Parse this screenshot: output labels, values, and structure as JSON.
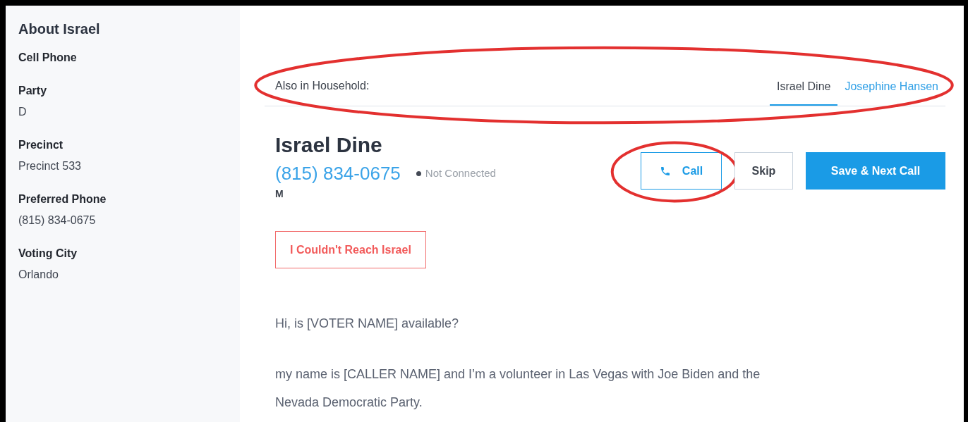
{
  "sidebar": {
    "title": "About Israel",
    "fields": [
      {
        "label": "Cell Phone"
      },
      {
        "label": "Party",
        "value": "D"
      },
      {
        "label": "Precinct",
        "value": "Precinct 533"
      },
      {
        "label": "Preferred Phone",
        "value": "(815) 834-0675"
      },
      {
        "label": "Voting City",
        "value": "Orlando"
      }
    ]
  },
  "household": {
    "label": "Also in Household:",
    "circled": true,
    "members": [
      {
        "name": "Israel Dine",
        "selected": true
      },
      {
        "name": "Josephine Hansen",
        "selected": false
      }
    ]
  },
  "contact": {
    "name": "Israel Dine",
    "phone": "(815) 834-0675",
    "status": "Not Connected",
    "gender": "M"
  },
  "actions": [
    {
      "kind": "call",
      "label": "Call",
      "circled": true
    },
    {
      "kind": "skip",
      "label": "Skip",
      "circled": false
    },
    {
      "kind": "primary",
      "label": "Save & Next Call",
      "circled": false
    }
  ],
  "unreachable_button": "I Couldn't Reach Israel",
  "script": [
    "Hi, is [VOTER NAME] available?",
    "my name is [CALLER NAME] and I’m a volunteer in Las Vegas with Joe Biden and the Nevada Democratic Party."
  ]
}
